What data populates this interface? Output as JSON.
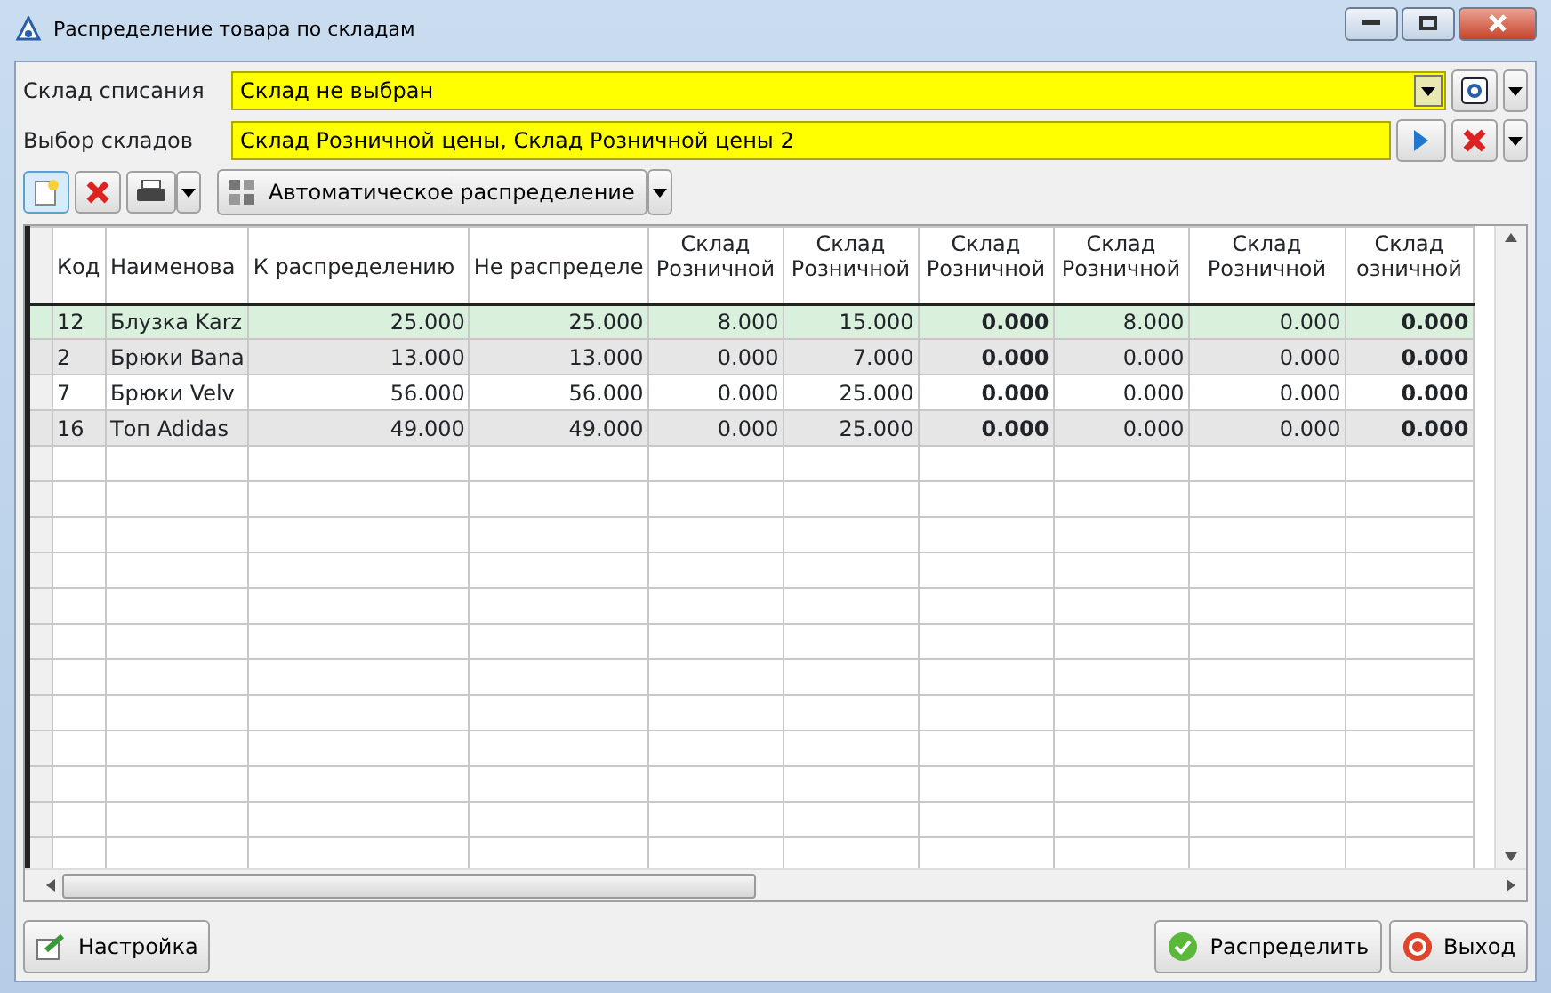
{
  "window": {
    "title": "Распределение товара по складам"
  },
  "fields": [
    {
      "label": "Склад списания",
      "value": "Склад не выбран",
      "kind": "combo"
    },
    {
      "label": "Выбор складов",
      "value": "Склад Розничной цены, Склад Розничной цены 2",
      "kind": "picker"
    }
  ],
  "toolbar": {
    "auto_button": "Автоматическое распределение"
  },
  "table": {
    "columns": [
      {
        "label": "Код",
        "bold": false
      },
      {
        "label": "Наименова",
        "bold": false
      },
      {
        "label": "К распределению",
        "bold": false
      },
      {
        "label": "Не распределе",
        "bold": false
      },
      {
        "label": "Склад Розничной",
        "bold": false
      },
      {
        "label": "Склад Розничной",
        "bold": false
      },
      {
        "label": "Склад Розничной",
        "bold": true
      },
      {
        "label": "Склад Розничной",
        "bold": false
      },
      {
        "label": "Склад Розничной",
        "bold": false
      },
      {
        "label": "Склад озничной",
        "bold": true
      }
    ],
    "rows": [
      {
        "selected": true,
        "cells": [
          "12",
          "Блузка Karz",
          "25.000",
          "25.000",
          "8.000",
          "15.000",
          "0.000",
          "8.000",
          "0.000",
          "0.000"
        ]
      },
      {
        "selected": false,
        "cells": [
          "2",
          "Брюки Bana",
          "13.000",
          "13.000",
          "0.000",
          "7.000",
          "0.000",
          "0.000",
          "0.000",
          "0.000"
        ]
      },
      {
        "selected": false,
        "cells": [
          "7",
          "Брюки Velv",
          "56.000",
          "56.000",
          "0.000",
          "25.000",
          "0.000",
          "0.000",
          "0.000",
          "0.000"
        ]
      },
      {
        "selected": false,
        "cells": [
          "16",
          "Топ Adidas",
          "49.000",
          "49.000",
          "0.000",
          "25.000",
          "0.000",
          "0.000",
          "0.000",
          "0.000"
        ]
      }
    ]
  },
  "footer": {
    "settings_button": "Настройка",
    "distribute_button": "Распределить",
    "exit_button": "Выход"
  }
}
